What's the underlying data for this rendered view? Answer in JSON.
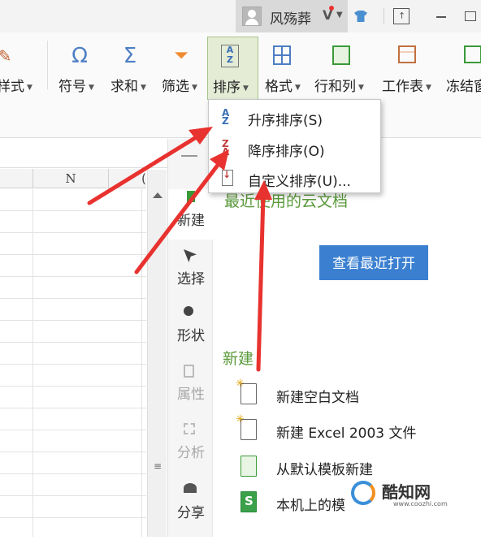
{
  "titlebar": {
    "username": "风殇葬",
    "vip_badge": "V",
    "icons": [
      "avatar-icon",
      "shirt-icon",
      "upload-icon",
      "minimize-icon",
      "restore-icon"
    ]
  },
  "ribbon": {
    "style_label": "样式",
    "symbol_label": "符号",
    "symbol_icon": "Ω",
    "sum_label": "求和",
    "sum_icon": "Σ",
    "filter_label": "筛选",
    "sort_label": "排序",
    "format_label": "格式",
    "rowcol_label": "行和列",
    "sheet_label": "工作表",
    "freeze_label": "冻结窗"
  },
  "sort_menu": {
    "ascending": "升序排序(S)",
    "descending": "降序排序(O)",
    "custom": "自定义排序(U)..."
  },
  "sheet": {
    "column_n": "N",
    "column_o": "("
  },
  "side_nav": {
    "new": "新建",
    "select": "选择",
    "shape": "形状",
    "property": "属性",
    "analysis": "分析",
    "share": "分享"
  },
  "panel": {
    "recent_title": "最近使用的云文档",
    "open_recent": "查看最近打开",
    "new_title": "新建",
    "new_blank": "新建空白文档",
    "new_excel": "新建 Excel 2003 文件",
    "new_template": "从默认模板新建",
    "local": "本机上的模"
  },
  "watermark": {
    "name": "酷知网",
    "url": "www.coozhi.com"
  },
  "colors": {
    "accent_green": "#5a9a3a",
    "button_blue": "#3a7fd0",
    "arrow_red": "#e8322f"
  }
}
